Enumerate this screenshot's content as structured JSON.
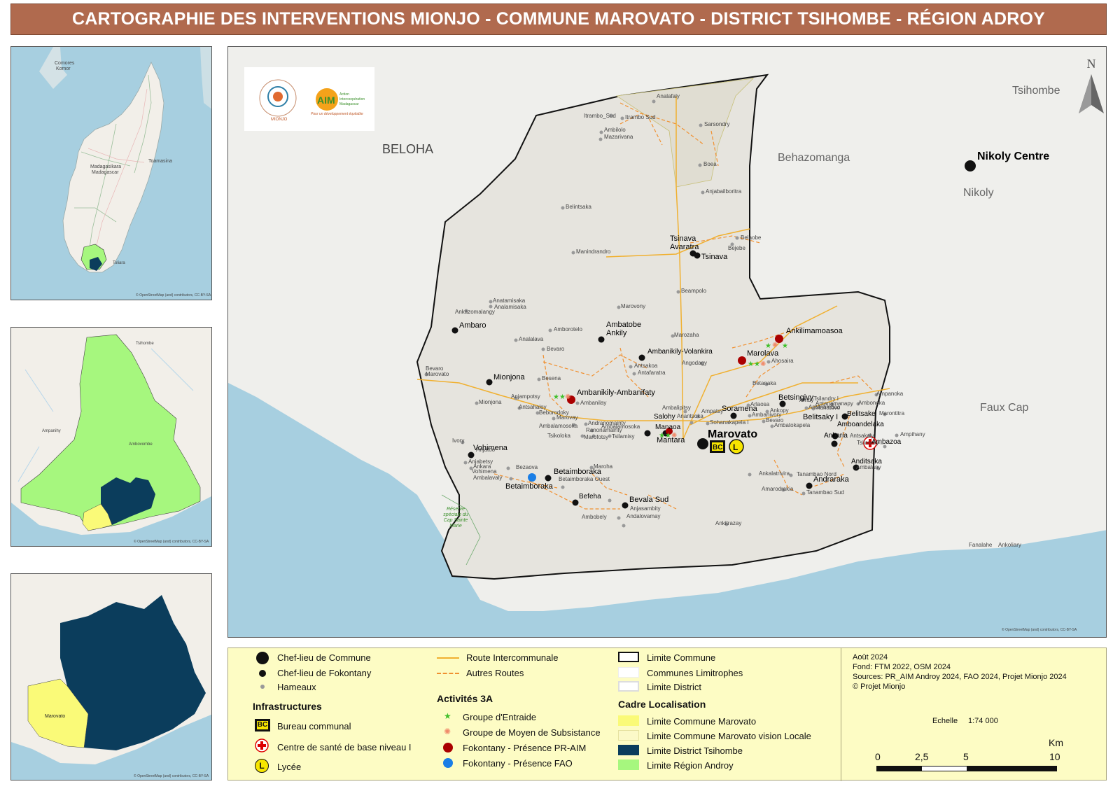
{
  "title": "CARTOGRAPHIE DES INTERVENTIONS MIONJO - COMMUNE MAROVATO - DISTRICT TSIHOMBE - RÉGION ADROY",
  "colors": {
    "title_bg": "#b06a4e",
    "sea": "#a7cfe0",
    "land": "#efefec",
    "commune_fill": "#e6e4de",
    "district": "#0b3d5c",
    "region": "#a6f77e",
    "marovato": "#fafa78",
    "legend_bg": "#fdfcc4",
    "route_main": "#f0b030",
    "route_other": "#f09030",
    "pr_aim": "#aa0000",
    "fao": "#1a7ee6",
    "groupe_entraide": "#3fbf2a",
    "groupe_subsistance": "#f08a6a"
  },
  "insets": {
    "madagascar": {
      "labels": [
        "Comores",
        "Komor",
        "Madagasikara",
        "Madagascar",
        "Toamasina",
        "Toliara"
      ],
      "credit": "© OpenStreetMap (and) contributors, CC-BY-SA"
    },
    "androy": {
      "labels": [
        "Ampanihy",
        "Ambovombe",
        "Tsihombe"
      ],
      "credit": "© OpenStreetMap (and) contributors, CC-BY-SA"
    },
    "tsihombe": {
      "labels": [
        "Marovato"
      ],
      "credit": "© OpenStreetMap (and) contributors, CC-BY-SA"
    }
  },
  "map": {
    "north": "N",
    "credit": "© OpenStreetMap (and) contributors, CC-BY-SA",
    "logos": {
      "mionjo_caption": "MIONJO",
      "aim_short": "AIM",
      "aim_name_1": "Action",
      "aim_name_2": "Intercoopération",
      "aim_name_3": "Madagascar",
      "aim_slogan": "Pour un développement équitable"
    },
    "regions": [
      "BELOHA",
      "Behazomanga",
      "Tsihombe",
      "Nikoly",
      "Faux Cap"
    ],
    "chef_commune": [
      "Marovato",
      "Nikoly Centre"
    ],
    "fokontany": [
      "Tsinava Avaratra",
      "Tsinava",
      "Ambaro",
      "Ambatobe Ankily",
      "Mionjona",
      "Ambanikily-Volankira",
      "Ankilimamoasoa",
      "Marolava",
      "Ambanikily-Ambanifaty",
      "Betsingivy",
      "Soramena",
      "Belitsaky I",
      "Belitsake",
      "Amboandelaka",
      "Ankaria",
      "Ambazoa",
      "Salohy",
      "Manaoa",
      "Mantara",
      "Vohimena",
      "Betaimboraka",
      "Betaimboraka",
      "Befeha",
      "Bevala Sud",
      "Anditsaka",
      "Andraraka"
    ],
    "hamlets": [
      "Analafaly",
      "Itrambo_Sud",
      "Itrambo Sud",
      "Sarsondry",
      "Ambilolo",
      "Mazarivana",
      "Boea",
      "Anjabailboritra",
      "Belintsaka",
      "Bejebe",
      "Belaobe",
      "Manindrandro",
      "Beampolo",
      "Anatamisaka",
      "Analamisaka",
      "Ankazomalangy",
      "Marovony",
      "Amborotelo",
      "Marozaha",
      "Analalava",
      "Bevaro",
      "Antsakoa",
      "Antafaratra",
      "Angodagy",
      "Ahosaira",
      "Betanaka",
      "Bevaro Marovato",
      "Besena",
      "Anjampotsy",
      "Antsahaloy",
      "Ambanilay",
      "Mionjona",
      "Beborodoky",
      "Marovay",
      "Ambalamosoka",
      "Andranomainty",
      "Tsikoloka",
      "Ranonamainty",
      "Marofotsy",
      "Tsilamisy",
      "Ampatsy",
      "Ambalamosoka",
      "Ambalipitsy",
      "Anantsoka",
      "Arlaosa",
      "Ambanivory",
      "Ankopy",
      "Sohanakapela I",
      "Bevaro",
      "Ambatokapela",
      "Amby",
      "Antanambao",
      "Mahatovo",
      "Anjatoo",
      "Anjabetsy",
      "Bezaova",
      "Ambalavaly",
      "Betaimboraka Ouest",
      "Maroha",
      "Ivory",
      "Ankara",
      "Vohimena",
      "Ambobely",
      "Anjasambity",
      "Andalovamay",
      "Ankitrazay",
      "Ankalatrivira",
      "Tanambao Nord",
      "Amarodrakia",
      "Tanambao Sud",
      "Fanalahe",
      "Ankoliary",
      "Ampanoka",
      "Tsilandry I",
      "Antanamanapy",
      "Ambonoka",
      "Marontitra",
      "Tsilandry II",
      "Antsakaly",
      "Ambalany",
      "Ampihany",
      "Bekinso"
    ],
    "reserve": "Réserve spéciale du Cap Sainte Marie"
  },
  "legend": {
    "chef_commune": "Chef-lieu de Commune",
    "chef_fokontany": "Chef-lieu de Fokontany",
    "hameaux": "Hameaux",
    "infra_title": "Infrastructures",
    "bureau": "Bureau communal",
    "sante": "Centre de santé de base niveau I",
    "lycee": "Lycée",
    "route_inter": "Route Intercommunale",
    "autres_routes": "Autres Routes",
    "activites_title": "Activités 3A",
    "groupe_entraide": "Groupe d'Entraide",
    "groupe_subsistance": "Groupe de Moyen de Subsistance",
    "fokontany_praim": "Fokontany - Présence PR-AIM",
    "fokontany_fao": "Fokontany - Présence FAO",
    "limite_commune": "Limite Commune",
    "communes_limitrophes": "Communes Limitrophes",
    "limite_district": "Limite District",
    "cadre_title": "Cadre Localisation",
    "limite_marovato": "Limite Commune Marovato",
    "limite_marovato_locale": "Limite Commune Marovato vision Locale",
    "limite_tsihombe": "Limite District Tsihombe",
    "limite_androy": "Limite Région Androy",
    "bc_symbol": "BC",
    "lycee_symbol": "L",
    "date": "Août 2024",
    "fond": "Fond: FTM 2022, OSM 2024",
    "sources": "Sources: PR_AIM Androy 2024, FAO 2024, Projet Mionjo 2024",
    "copyright": "© Projet Mionjo",
    "echelle_label": "Echelle",
    "echelle_value": "1:74 000",
    "km": "Km",
    "ticks": [
      "0",
      "2,5",
      "5",
      "10"
    ]
  }
}
